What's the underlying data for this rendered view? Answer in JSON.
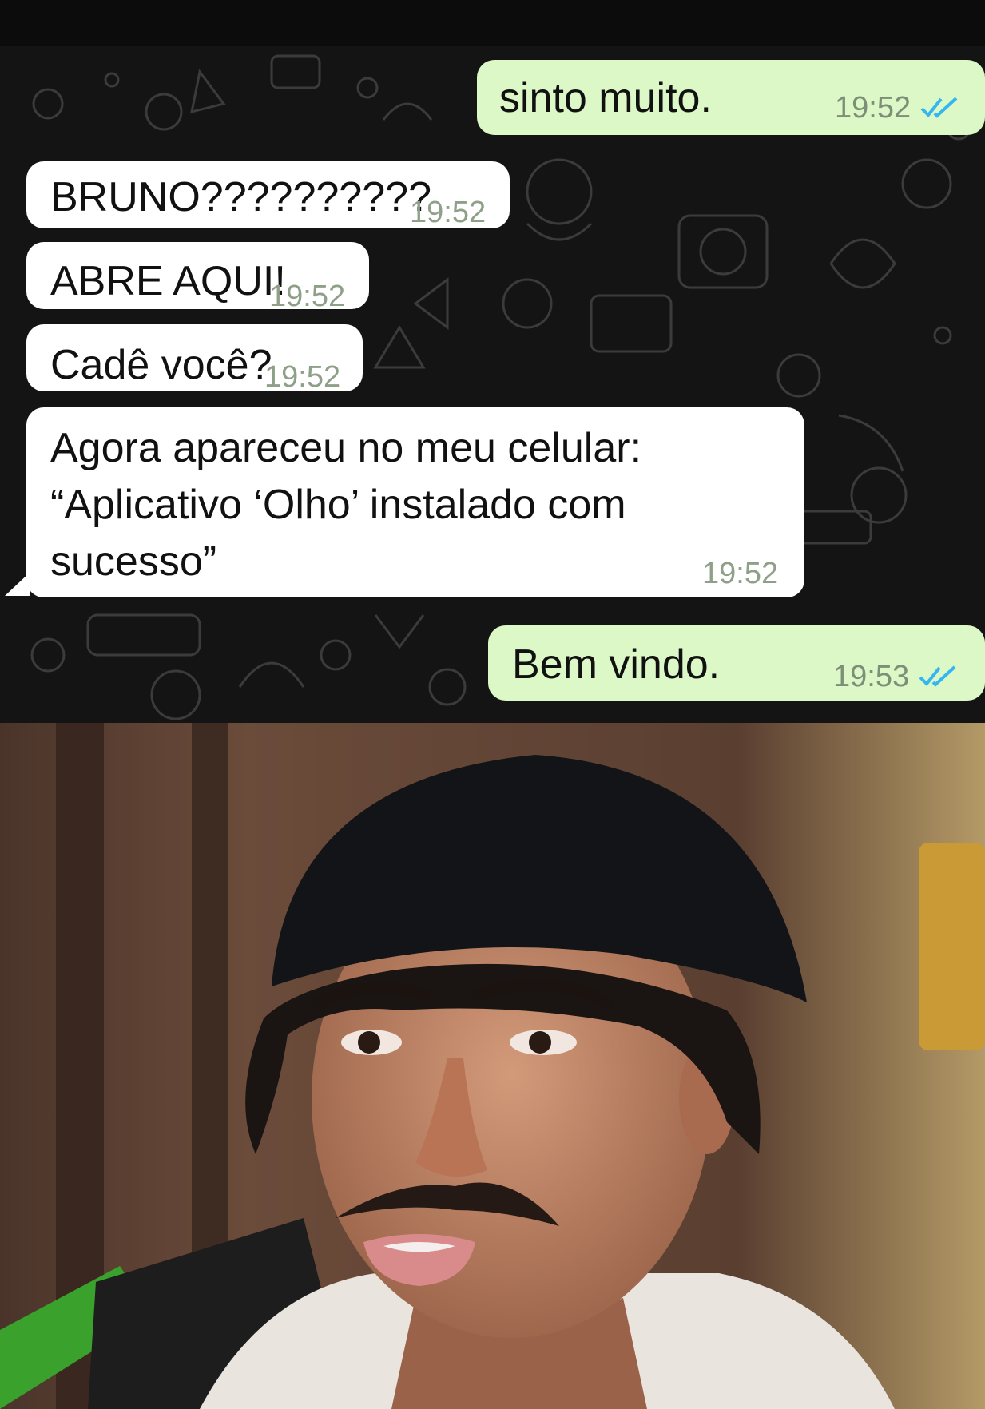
{
  "chat": {
    "messages": [
      {
        "direction": "outgoing",
        "text": "sinto muito.",
        "time": "19:52",
        "status": "read",
        "status_icon": "double-check-icon"
      },
      {
        "direction": "incoming",
        "text": "BRUNO??????????",
        "time": "19:52"
      },
      {
        "direction": "incoming",
        "text": "ABRE AQUI!",
        "time": "19:52"
      },
      {
        "direction": "incoming",
        "text": "Cadê você?",
        "time": "19:52"
      },
      {
        "direction": "incoming",
        "lines": [
          "Agora apareceu no meu celular:",
          "“Aplicativo ‘Olho’ instalado com",
          "sucesso”"
        ],
        "time": "19:52"
      },
      {
        "direction": "outgoing",
        "text": "Bem vindo.",
        "time": "19:53",
        "status": "read",
        "status_icon": "double-check-icon"
      }
    ],
    "colors": {
      "outgoing_bubble": "#dcf8c6",
      "incoming_bubble": "#ffffff",
      "wallpaper": "#141414",
      "read_ticks": "#34b7f1"
    }
  },
  "photo": {
    "subject": "person-reaction-icon"
  }
}
